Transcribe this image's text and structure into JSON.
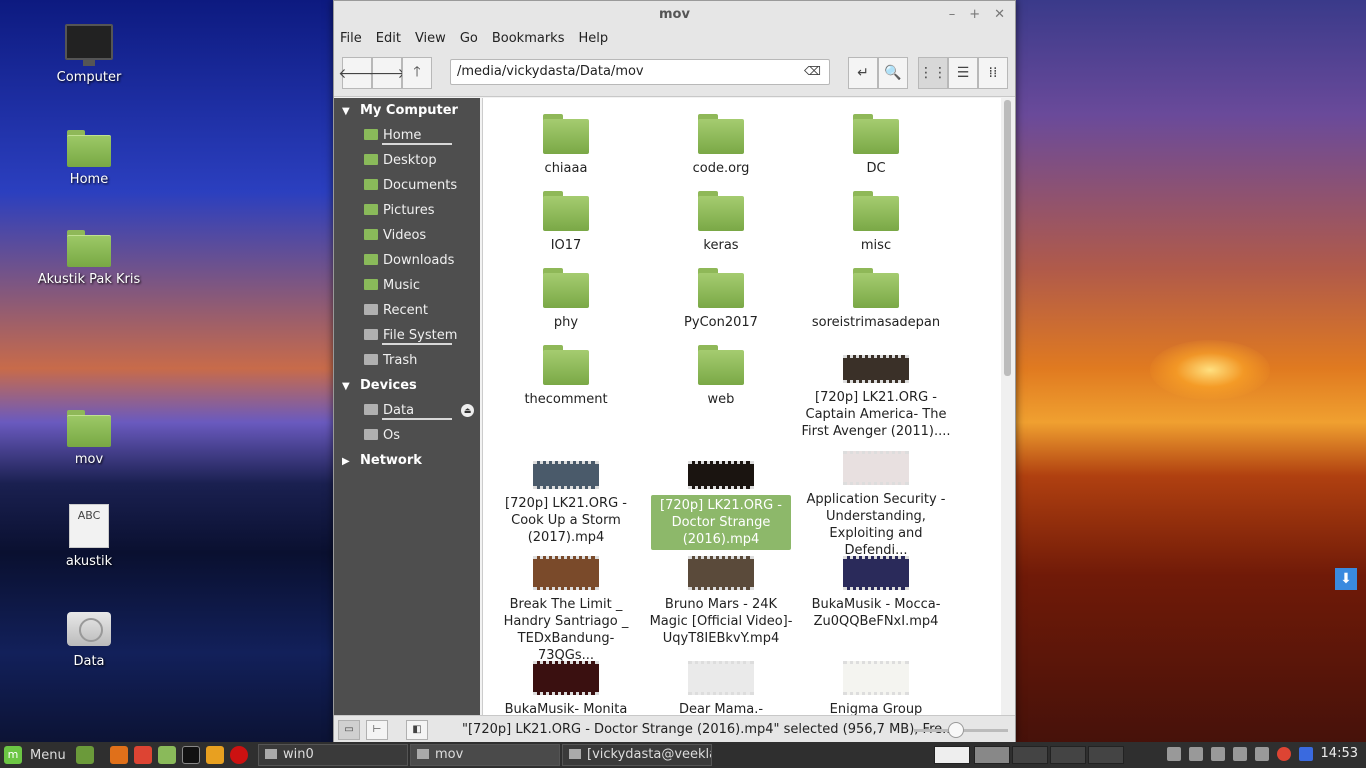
{
  "desktop": {
    "icons": [
      {
        "label": "Computer"
      },
      {
        "label": "Home"
      },
      {
        "label": "Akustik Pak Kris"
      },
      {
        "label": "mov"
      },
      {
        "label": "akustik",
        "preview_text": "ABC"
      },
      {
        "label": "Data"
      }
    ]
  },
  "window": {
    "title": "mov",
    "controls": {
      "minimize": "–",
      "maximize": "+",
      "close": "✕"
    },
    "menu": [
      "File",
      "Edit",
      "View",
      "Go",
      "Bookmarks",
      "Help"
    ],
    "toolbar": {
      "back": "🡐",
      "forward": "🡒",
      "up": "🡑",
      "path": "/media/vickydasta/Data/mov",
      "clear": "⌫",
      "toggle_location": "↵",
      "search": "🔍",
      "view_icons": "⋮⋮",
      "view_list": "☰",
      "view_compact": "⁞⁞"
    },
    "sidebar": {
      "sections": [
        {
          "title": "My Computer",
          "items": [
            "Home",
            "Desktop",
            "Documents",
            "Pictures",
            "Videos",
            "Downloads",
            "Music",
            "Recent",
            "File System",
            "Trash"
          ]
        },
        {
          "title": "Devices",
          "items": [
            "Data",
            "Os"
          ]
        },
        {
          "title": "Network",
          "items": []
        }
      ]
    },
    "files": [
      {
        "name": "chiaaa",
        "type": "folder"
      },
      {
        "name": "code.org",
        "type": "folder"
      },
      {
        "name": "DC",
        "type": "folder"
      },
      {
        "name": "IO17",
        "type": "folder"
      },
      {
        "name": "keras",
        "type": "folder"
      },
      {
        "name": "misc",
        "type": "folder"
      },
      {
        "name": "phy",
        "type": "folder"
      },
      {
        "name": "PyCon2017",
        "type": "folder"
      },
      {
        "name": "soreistrimasadepan",
        "type": "folder"
      },
      {
        "name": "thecomment",
        "type": "folder"
      },
      {
        "name": "web",
        "type": "folder"
      },
      {
        "name": "[720p] LK21.ORG - Captain America- The First Avenger (2011)....",
        "type": "video"
      },
      {
        "name": "[720p] LK21.ORG - Cook Up a Storm (2017).mp4",
        "type": "video"
      },
      {
        "name": "[720p] LK21.ORG - Doctor Strange (2016).mp4",
        "type": "video",
        "selected": true
      },
      {
        "name": "Application Security - Understanding, Exploiting and Defendi...",
        "type": "video"
      },
      {
        "name": "Break The Limit _ Handry Santriago _ TEDxBandung-73QGs...",
        "type": "video"
      },
      {
        "name": "Bruno Mars - 24K Magic [Official Video]-UqyT8IEBkvY.mp4",
        "type": "video"
      },
      {
        "name": "BukaMusik - Mocca-Zu0QQBeFNxI.mp4",
        "type": "video"
      },
      {
        "name": "BukaMusik- Monita",
        "type": "video"
      },
      {
        "name": "Dear Mama.-",
        "type": "video"
      },
      {
        "name": "Enigma Group",
        "type": "video"
      }
    ],
    "status": {
      "text": "\"[720p] LK21.ORG - Doctor Strange (2016).mp4\" selected (956,7 MB), Fre...",
      "zoom_level": 0.45
    }
  },
  "taskbar": {
    "menu_label": "Menu",
    "windows": [
      {
        "label": "win0"
      },
      {
        "label": "mov"
      },
      {
        "label": "[vickydasta@veekla..."
      }
    ],
    "clock": "14:53"
  }
}
